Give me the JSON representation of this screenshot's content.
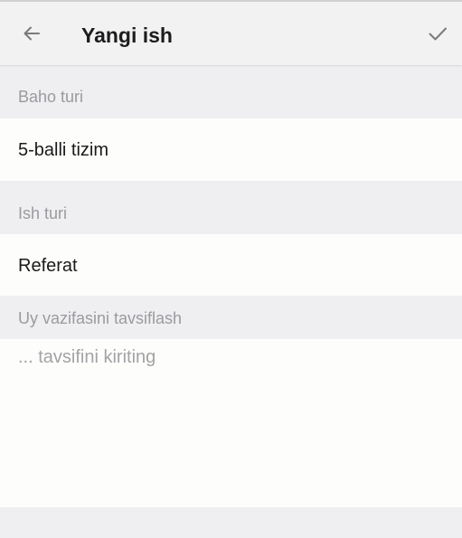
{
  "header": {
    "title": "Yangi ish",
    "back_icon": "arrow-left-icon",
    "confirm_icon": "checkmark-icon"
  },
  "form": {
    "grade_type": {
      "label": "Baho turi",
      "value": "5-balli tizim"
    },
    "work_type": {
      "label": "Ish turi",
      "value": "Referat"
    },
    "description": {
      "label": "Uy vazifasini tavsiflash",
      "placeholder": "... tavsifini kiriting",
      "value": ""
    }
  },
  "colors": {
    "toolbar_bg": "#f2f2f2",
    "page_bg": "#efeff2",
    "field_bg": "#fdfdfb",
    "label_text": "#9b9b9f",
    "value_text": "#1a1a1a"
  }
}
